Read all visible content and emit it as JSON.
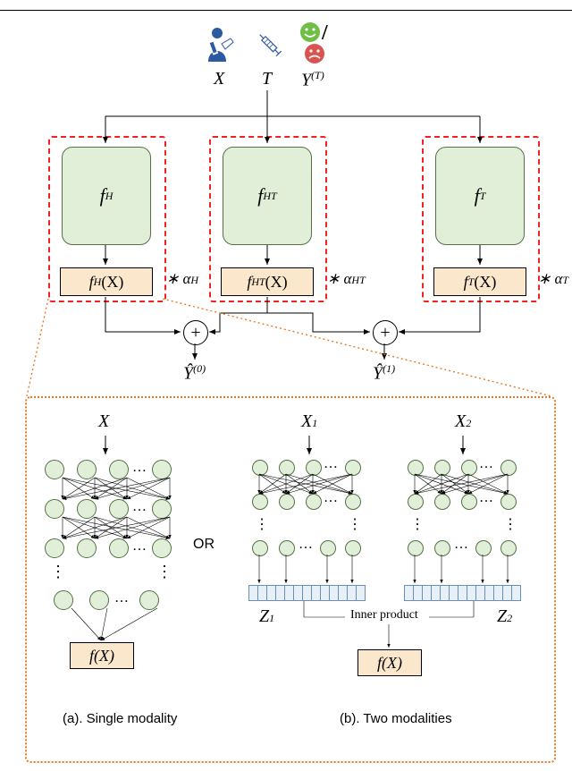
{
  "top": {
    "X": "X",
    "T": "T",
    "YT": "Y",
    "YT_sup": "(T)"
  },
  "boxes": {
    "fH": "f",
    "fH_sub": "H",
    "fHT": "f",
    "fHT_sub": "HT",
    "fT": "f",
    "fT_sub": "T"
  },
  "out": {
    "fHX": "f",
    "fHX_sub": "H",
    "fHX_arg": "(X)",
    "fHTX": "f",
    "fHTX_sub": "HT",
    "fHTX_arg": "(X)",
    "fTX": "f",
    "fTX_sub": "T",
    "fTX_arg": "(X)"
  },
  "alpha": {
    "aH": "∗ α",
    "aH_sub": "H",
    "aHT": "∗ α",
    "aHT_sub": "HT",
    "aT": "∗ α",
    "aT_sub": "T"
  },
  "yhat": {
    "y0": "Ŷ",
    "y0_sup": "(0)",
    "y1": "Ŷ",
    "y1_sup": "(1)"
  },
  "lower": {
    "X": "X",
    "X1": "X",
    "X1_sub": "1",
    "X2": "X",
    "X2_sub": "2",
    "Z1": "Z",
    "Z1_sub": "1",
    "Z2": "Z",
    "Z2_sub": "2",
    "fX": "f(X)",
    "inner": "Inner product",
    "OR": "OR",
    "capA": "(a). Single modality",
    "capB": "(b). Two modalities"
  }
}
